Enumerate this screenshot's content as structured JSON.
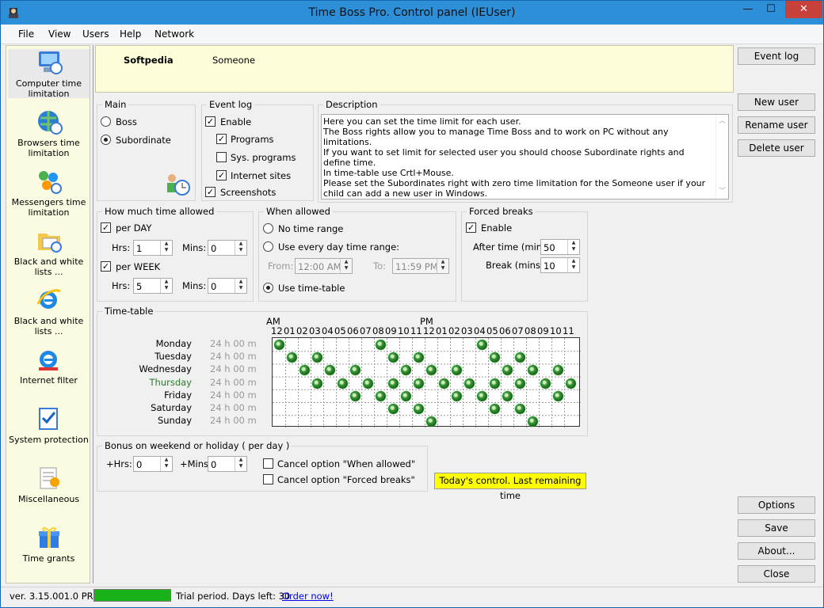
{
  "window": {
    "title": "Time Boss Pro. Control panel (IEUser)",
    "minimize": "—",
    "maximize": "☐",
    "close": "✕"
  },
  "menu": [
    "File",
    "View",
    "Users",
    "Help",
    "Network"
  ],
  "sidebar": [
    {
      "label": "Computer time limitation",
      "icon": "computer-icon"
    },
    {
      "label": "Browsers time limitation",
      "icon": "globe-icon"
    },
    {
      "label": "Messengers time limitation",
      "icon": "messenger-icon"
    },
    {
      "label": "Black and white lists ...",
      "icon": "folder-icon"
    },
    {
      "label": "Black and white lists ...",
      "icon": "ie-icon"
    },
    {
      "label": "Internet filter",
      "icon": "ie-icon"
    },
    {
      "label": "System protection",
      "icon": "shield-icon"
    },
    {
      "label": "Miscellaneous",
      "icon": "tools-icon"
    },
    {
      "label": "Time grants",
      "icon": "gift-icon"
    }
  ],
  "header": {
    "user": "Softpedia",
    "name": "Someone"
  },
  "main": {
    "title": "Main",
    "boss": "Boss",
    "subordinate": "Subordinate"
  },
  "eventlog": {
    "title": "Event log",
    "enable": "Enable",
    "programs": "Programs",
    "sys": "Sys. programs",
    "internet": "Internet sites",
    "screenshots": "Screenshots"
  },
  "description": {
    "title": "Description",
    "text": "Here you can set the time limit for each user.\nThe Boss rights allow you to manage Time Boss and to work on PC without any limitations.\nIf you want to set limit for selected user you should choose Subordinate rights and define time.\nIn time-table use Crtl+Mouse.\nPlease set the Subordinates right with zero time limitation for the Someone user if your child can add a new user in Windows."
  },
  "howmuch": {
    "title": "How much time allowed",
    "perday": "per DAY",
    "perweek": "per WEEK",
    "hrs": "Hrs:",
    "mins": "Mins:",
    "day_hrs": "1",
    "day_mins": "0",
    "week_hrs": "5",
    "week_mins": "0"
  },
  "when": {
    "title": "When allowed",
    "no_range": "No time range",
    "every_day": "Use every day time range:",
    "from": "From:",
    "from_val": "12:00 AM",
    "to": "To:",
    "to_val": "11:59 PM",
    "timetable": "Use time-table"
  },
  "forced": {
    "title": "Forced breaks",
    "enable": "Enable",
    "after": "After time (mins):",
    "after_val": "50",
    "break": "Break (mins):",
    "break_val": "10"
  },
  "timetable": {
    "title": "Time-table",
    "am": "AM",
    "pm": "PM",
    "hours": [
      "12",
      "01",
      "02",
      "03",
      "04",
      "05",
      "06",
      "07",
      "08",
      "09",
      "10",
      "11",
      "12",
      "01",
      "02",
      "03",
      "04",
      "05",
      "06",
      "07",
      "08",
      "09",
      "10",
      "11"
    ],
    "days": [
      {
        "name": "Monday",
        "total": "24 h 00 m",
        "slots": [
          0,
          8,
          16
        ]
      },
      {
        "name": "Tuesday",
        "total": "24 h 00 m",
        "slots": [
          1,
          3,
          9,
          11,
          17,
          19
        ]
      },
      {
        "name": "Wednesday",
        "total": "24 h 00 m",
        "slots": [
          2,
          4,
          6,
          10,
          12,
          14,
          18,
          20,
          22
        ]
      },
      {
        "name": "Thursday",
        "total": "24 h 00 m",
        "slots": [
          3,
          5,
          7,
          9,
          11,
          13,
          15,
          17,
          19,
          21,
          23
        ]
      },
      {
        "name": "Friday",
        "total": "24 h 00 m",
        "slots": [
          6,
          8,
          10,
          14,
          16,
          18,
          22
        ]
      },
      {
        "name": "Saturday",
        "total": "24 h 00 m",
        "slots": [
          9,
          11,
          17,
          19
        ]
      },
      {
        "name": "Sunday",
        "total": "24 h 00 m",
        "slots": [
          12,
          20
        ]
      }
    ]
  },
  "bonus": {
    "title": "Bonus on weekend or holiday ( per day )",
    "hrs": "+Hrs:",
    "hrs_val": "0",
    "mins": "+Mins",
    "mins_val": "0",
    "cancel_when": "Cancel option \"When allowed\"",
    "cancel_forced": "Cancel option \"Forced breaks\""
  },
  "today": "Today's control. Last remaining time",
  "buttons": {
    "eventlog": "Event log",
    "newuser": "New user",
    "rename": "Rename user",
    "delete": "Delete user",
    "options": "Options",
    "save": "Save",
    "about": "About...",
    "close": "Close"
  },
  "status": {
    "version": "ver. 3.15.001.0 PRO",
    "trial": "Trial period. Days left: 30",
    "order": "Order now!"
  },
  "colors": {
    "accent": "#2d8fd8",
    "sidebar": "#fbfbe1",
    "highlight": "#ffff00",
    "progress": "#19b219"
  }
}
